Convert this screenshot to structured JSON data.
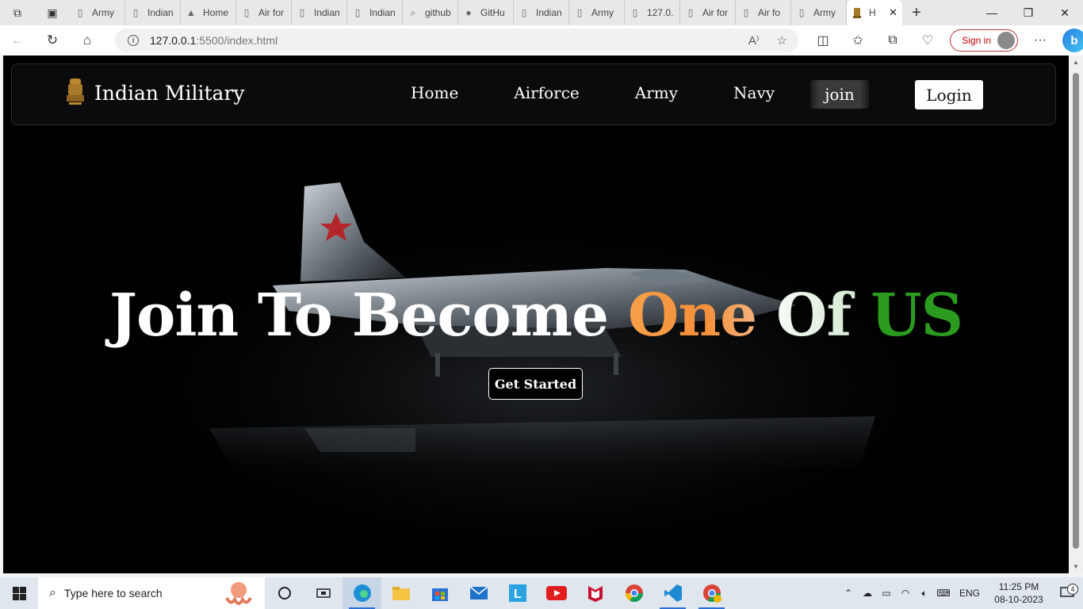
{
  "browser": {
    "tabs": [
      {
        "label": "Army",
        "icon": "page-icon"
      },
      {
        "label": "Indian",
        "icon": "page-icon"
      },
      {
        "label": "Home",
        "icon": "emblem-icon"
      },
      {
        "label": "Air for",
        "icon": "page-icon"
      },
      {
        "label": "Indian",
        "icon": "page-icon"
      },
      {
        "label": "Indian",
        "icon": "page-icon"
      },
      {
        "label": "github",
        "icon": "search-icon"
      },
      {
        "label": "GitHu",
        "icon": "github-icon"
      },
      {
        "label": "Indian",
        "icon": "page-icon"
      },
      {
        "label": "Army",
        "icon": "page-icon"
      },
      {
        "label": "127.0.",
        "icon": "page-icon"
      },
      {
        "label": "Air for",
        "icon": "page-icon"
      },
      {
        "label": "Air fo",
        "icon": "page-icon"
      },
      {
        "label": "Army",
        "icon": "page-icon"
      }
    ],
    "active_tab": {
      "label": "H",
      "icon": "emblem-icon"
    },
    "url_host": "127.0.0.1",
    "url_path": ":5500/index.html",
    "signin_label": "Sign in"
  },
  "site": {
    "brand": "Indian Military",
    "nav": [
      "Home",
      "Airforce",
      "Army",
      "Navy"
    ],
    "join_label": "join",
    "login_label": "Login",
    "headline": {
      "part1": "Join To Become ",
      "part2": "One",
      "part3": " Of ",
      "part4": "US"
    },
    "cta_label": "Get Started",
    "colors": {
      "saffron": "#f58f3a",
      "green": "#2a9b1e",
      "background": "#000000"
    }
  },
  "taskbar": {
    "search_placeholder": "Type here to search",
    "apps": [
      "task-view-icon",
      "widgets-icon",
      "edge-icon",
      "file-explorer-icon",
      "store-icon",
      "mail-icon",
      "l-app-icon",
      "youtube-icon",
      "mcafee-icon",
      "chrome-icon",
      "vscode-icon",
      "chrome-profile-icon"
    ],
    "language": "ENG",
    "time": "11:25 PM",
    "date": "08-10-2023",
    "notification_count": "4"
  }
}
